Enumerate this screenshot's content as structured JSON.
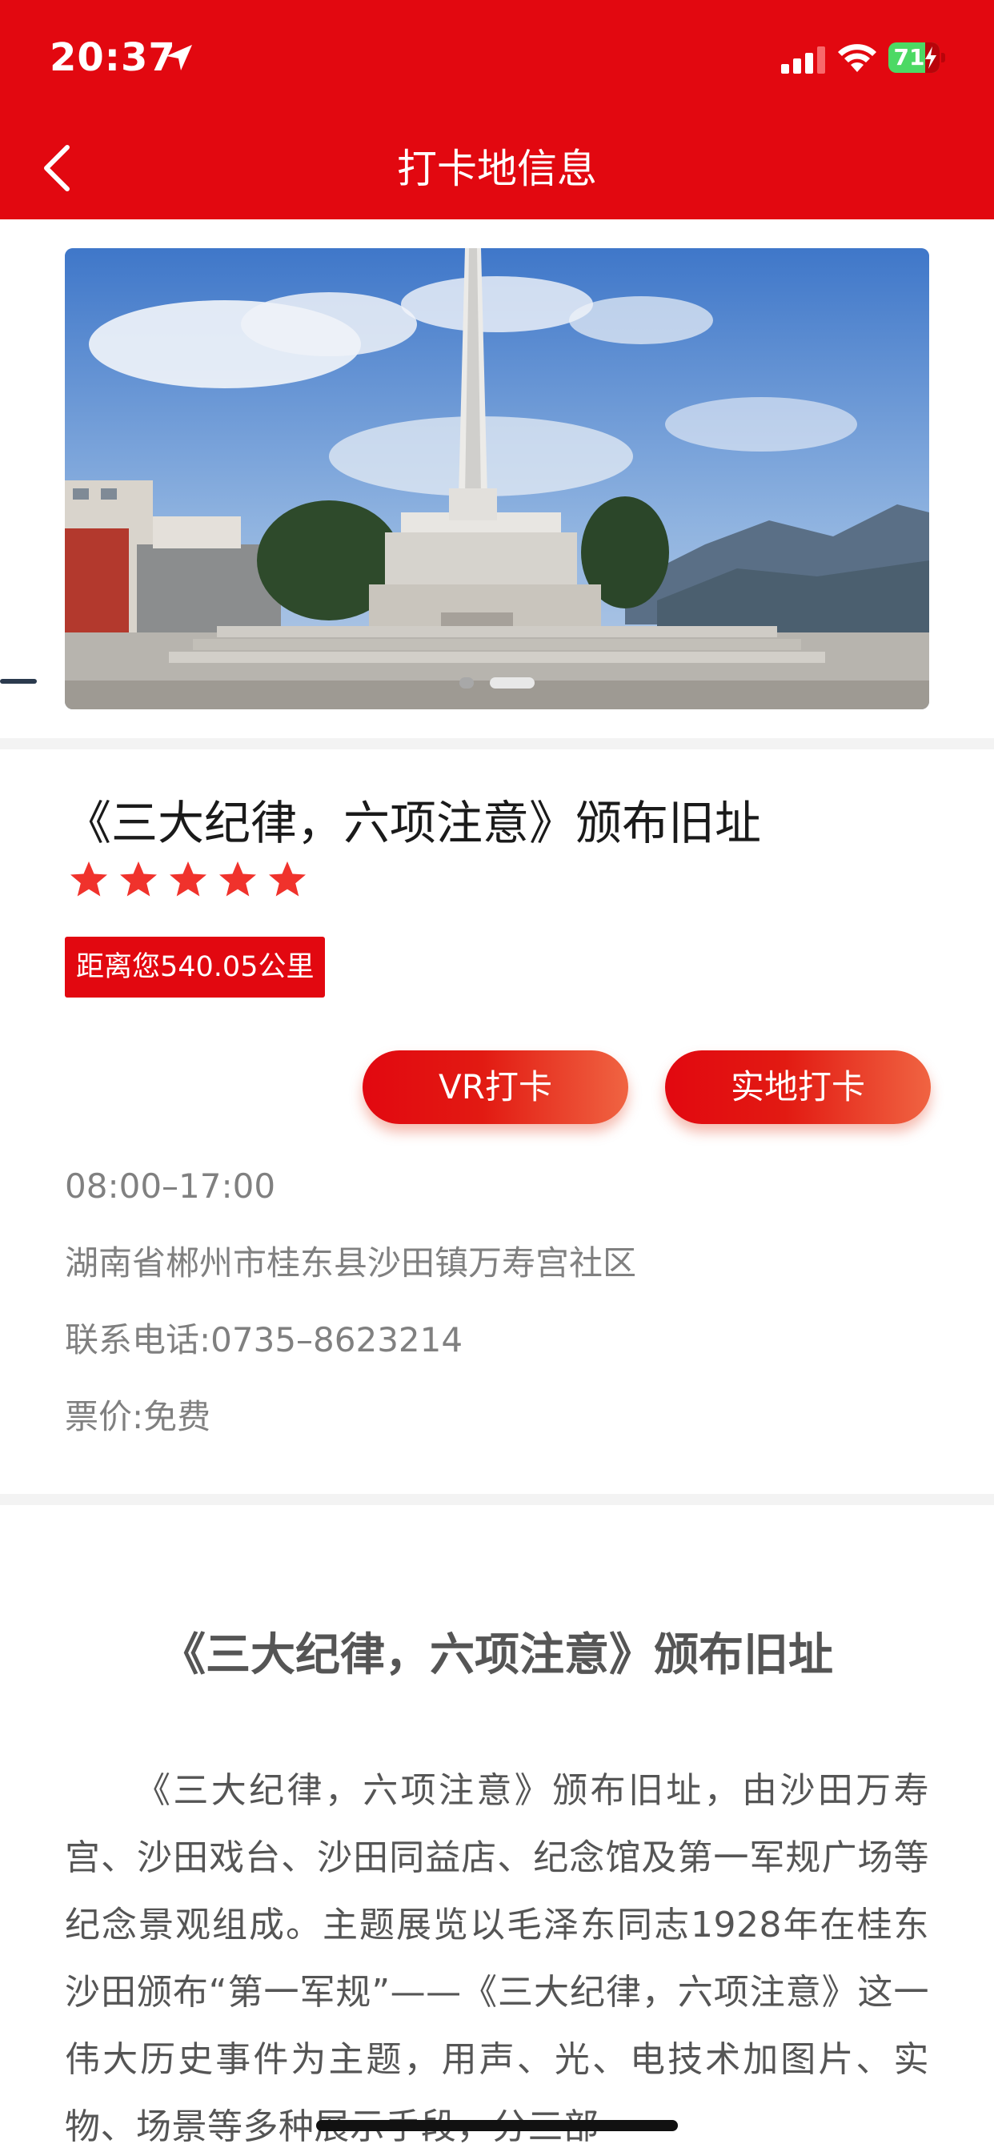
{
  "status_bar": {
    "time": "20:37",
    "battery": "71"
  },
  "header": {
    "title": "打卡地信息"
  },
  "place": {
    "name": "《三大纪律，六项注意》颁布旧址",
    "rating": 5,
    "rating_max": 5,
    "distance": "距离您540.05公里",
    "hours": "08:00–17:00",
    "address": "湖南省郴州市桂东县沙田镇万寿宫社区",
    "phone": "联系电话:0735–8623214",
    "price": "票价:免费"
  },
  "buttons": {
    "vr_label": "VR打卡",
    "real_label": "实地打卡"
  },
  "carousel": {
    "total": 2,
    "active": 2
  },
  "article": {
    "title": "《三大纪律，六项注意》颁布旧址",
    "body": "《三大纪律，六项注意》颁布旧址，由沙田万寿宫、沙田戏台、沙田同益店、纪念馆及第一军规广场等纪念景观组成。主题展览以毛泽东同志1928年在桂东沙田颁布“第一军规”——《三大纪律，六项注意》这一伟大历史事件为主题，用声、光、电技术加图片、实物、场景等多种展示手段，分三部"
  },
  "colors": {
    "primary_red": "#e20810",
    "gradient_end": "#f06442",
    "text_gray": "#808080",
    "battery_green": "#4cd964"
  },
  "icons": {
    "back": "chevron-left-icon",
    "location": "location-arrow-icon",
    "signal": "cellular-signal-icon",
    "wifi": "wifi-icon",
    "battery": "battery-charging-icon",
    "star": "star-icon"
  }
}
